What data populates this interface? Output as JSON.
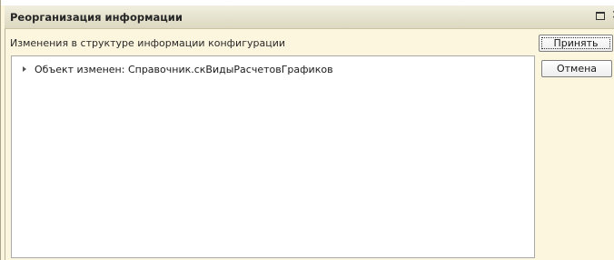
{
  "window": {
    "title": "Реорганизация информации"
  },
  "content": {
    "subtitle": "Изменения в структуре информации конфигурации",
    "items": [
      {
        "label": "Объект изменен: Справочник.скВидыРасчетовГрафиков"
      }
    ]
  },
  "buttons": {
    "accept_label": "Принять",
    "cancel_label": "Отмена"
  },
  "icons": {
    "maximize": "maximize-icon",
    "close": "close-icon",
    "expand": "expand-arrow-icon"
  },
  "colors": {
    "window_background": "#fbf6dd",
    "titlebar_top": "#f0eedf",
    "titlebar_bottom": "#dcd8c0"
  }
}
